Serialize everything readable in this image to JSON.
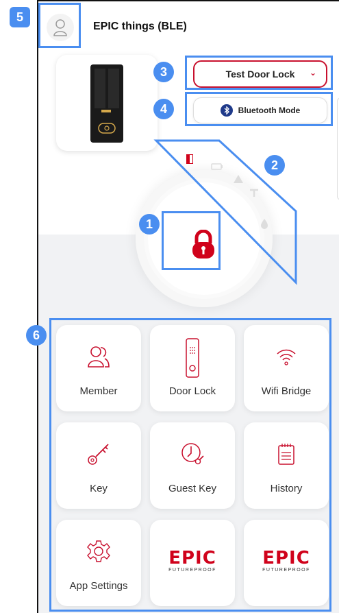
{
  "header": {
    "title": "EPIC things (BLE)"
  },
  "device": {
    "name": "Test Door Lock",
    "chevron": "⌄"
  },
  "mode": {
    "label": "Bluetooth Mode"
  },
  "colors": {
    "accent": "#c8102e",
    "highlight": "#4a8ef0"
  },
  "annotations": [
    "1",
    "2",
    "3",
    "4",
    "5",
    "6"
  ],
  "menu": {
    "items": [
      {
        "label": "Member",
        "icon": "member-icon"
      },
      {
        "label": "Door Lock",
        "icon": "door-lock-icon"
      },
      {
        "label": "Wifi Bridge",
        "icon": "wifi-icon"
      },
      {
        "label": "Key",
        "icon": "key-icon"
      },
      {
        "label": "Guest Key",
        "icon": "guest-key-icon"
      },
      {
        "label": "History",
        "icon": "history-icon"
      },
      {
        "label": "App Settings",
        "icon": "gear-icon"
      }
    ],
    "brand": {
      "word": "EPIC",
      "tagline": "FUTUREPROOF"
    }
  }
}
